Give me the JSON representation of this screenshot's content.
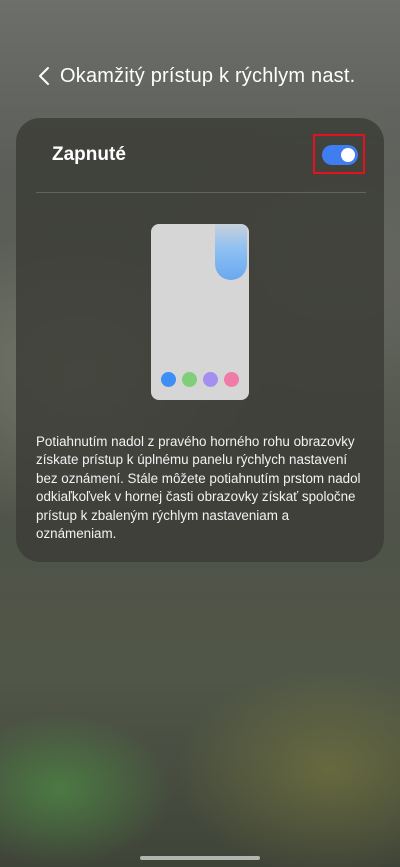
{
  "header": {
    "title": "Okamžitý prístup k rýchlym nast."
  },
  "toggle": {
    "label": "Zapnuté",
    "state": "on",
    "color": "#3e7ef0",
    "highlight_color": "#e3121e"
  },
  "illustration": {
    "dock_colors": [
      "#3d8ef5",
      "#7fcf7a",
      "#a48ff0",
      "#f07aa8"
    ],
    "indicator_color": "#6aa8f0"
  },
  "description": "Potiahnutím nadol z pravého horného rohu obrazovky získate prístup k úplnému panelu rýchlych nastavení bez oznámení. Stále môžete potiahnutím prstom nadol odkiaľkoľvek v hornej časti obrazovky získať spoločne prístup k zbaleným rýchlym nastaveniam a oznámeniam.",
  "icons": {
    "back": "chevron-left-icon"
  }
}
